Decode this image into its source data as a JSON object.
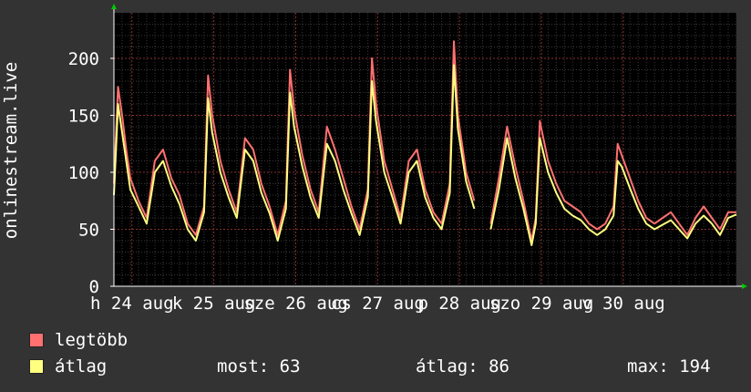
{
  "chart_data": {
    "type": "line",
    "ylabel": "onlinestream.live",
    "ylim": [
      0,
      240
    ],
    "yticks": [
      0,
      50,
      100,
      150,
      200
    ],
    "xlim": [
      0,
      7.6
    ],
    "x_labels": [
      {
        "x": 0.22,
        "text": "h 24 aug"
      },
      {
        "x": 1.22,
        "text": "k 25 aug"
      },
      {
        "x": 2.22,
        "text": "sze 26 aug"
      },
      {
        "x": 3.22,
        "text": "cs 27 aug"
      },
      {
        "x": 4.22,
        "text": "p 28 aug"
      },
      {
        "x": 5.22,
        "text": "szo 29 aug"
      },
      {
        "x": 6.22,
        "text": "v 30 aug"
      }
    ],
    "grid": true,
    "series": [
      {
        "name": "legtöbb",
        "color": "#ff7070",
        "x": [
          0,
          0.05,
          0.1,
          0.15,
          0.2,
          0.3,
          0.4,
          0.5,
          0.6,
          0.7,
          0.8,
          0.9,
          1.0,
          1.1,
          1.15,
          1.2,
          1.3,
          1.4,
          1.5,
          1.6,
          1.7,
          1.8,
          1.9,
          2.0,
          2.1,
          2.15,
          2.2,
          2.3,
          2.4,
          2.5,
          2.6,
          2.7,
          2.8,
          2.9,
          3.0,
          3.1,
          3.15,
          3.2,
          3.3,
          3.4,
          3.5,
          3.6,
          3.7,
          3.8,
          3.9,
          4.0,
          4.1,
          4.15,
          4.2,
          4.3,
          4.4,
          4.5,
          4.6,
          4.7,
          4.8,
          4.9,
          5.0,
          5.1,
          5.15,
          5.2,
          5.3,
          5.4,
          5.5,
          5.6,
          5.7,
          5.8,
          5.9,
          6.0,
          6.1,
          6.15,
          6.2,
          6.3,
          6.4,
          6.5,
          6.6,
          6.7,
          6.8,
          6.9,
          7.0,
          7.1,
          7.2,
          7.3,
          7.4,
          7.5,
          7.6
        ],
        "values": [
          90,
          175,
          150,
          120,
          95,
          75,
          60,
          110,
          120,
          95,
          80,
          55,
          45,
          70,
          185,
          150,
          110,
          85,
          65,
          130,
          120,
          90,
          70,
          45,
          75,
          190,
          155,
          115,
          85,
          65,
          140,
          120,
          95,
          70,
          50,
          85,
          200,
          160,
          110,
          85,
          60,
          110,
          120,
          85,
          65,
          55,
          90,
          215,
          150,
          100,
          75,
          null,
          55,
          95,
          140,
          105,
          75,
          40,
          60,
          145,
          110,
          90,
          75,
          70,
          65,
          55,
          50,
          55,
          70,
          125,
          115,
          95,
          75,
          60,
          55,
          60,
          65,
          55,
          45,
          60,
          70,
          60,
          50,
          65,
          65
        ]
      },
      {
        "name": "átlag",
        "color": "#ffff80",
        "x": [
          0,
          0.05,
          0.1,
          0.15,
          0.2,
          0.3,
          0.4,
          0.5,
          0.6,
          0.7,
          0.8,
          0.9,
          1.0,
          1.1,
          1.15,
          1.2,
          1.3,
          1.4,
          1.5,
          1.6,
          1.7,
          1.8,
          1.9,
          2.0,
          2.1,
          2.15,
          2.2,
          2.3,
          2.4,
          2.5,
          2.6,
          2.7,
          2.8,
          2.9,
          3.0,
          3.1,
          3.15,
          3.2,
          3.3,
          3.4,
          3.5,
          3.6,
          3.7,
          3.8,
          3.9,
          4.0,
          4.1,
          4.15,
          4.2,
          4.3,
          4.4,
          4.5,
          4.6,
          4.7,
          4.8,
          4.9,
          5.0,
          5.1,
          5.15,
          5.2,
          5.3,
          5.4,
          5.5,
          5.6,
          5.7,
          5.8,
          5.9,
          6.0,
          6.1,
          6.15,
          6.2,
          6.3,
          6.4,
          6.5,
          6.6,
          6.7,
          6.8,
          6.9,
          7.0,
          7.1,
          7.2,
          7.3,
          7.4,
          7.5,
          7.6
        ],
        "values": [
          80,
          160,
          135,
          110,
          85,
          70,
          55,
          100,
          110,
          88,
          72,
          50,
          40,
          65,
          165,
          135,
          100,
          78,
          60,
          120,
          110,
          82,
          64,
          40,
          68,
          170,
          140,
          105,
          78,
          60,
          125,
          110,
          85,
          64,
          45,
          78,
          180,
          145,
          100,
          78,
          55,
          100,
          110,
          78,
          60,
          50,
          82,
          194,
          138,
          92,
          68,
          null,
          50,
          85,
          130,
          95,
          68,
          36,
          55,
          130,
          100,
          82,
          68,
          62,
          58,
          50,
          45,
          50,
          62,
          110,
          105,
          86,
          68,
          55,
          50,
          54,
          58,
          50,
          42,
          55,
          62,
          55,
          45,
          60,
          63
        ]
      }
    ]
  },
  "legend": [
    {
      "label": "legtöbb",
      "color": "#ff7070"
    },
    {
      "label": "átlag",
      "color": "#ffff80"
    }
  ],
  "stats": {
    "most": "most: 63",
    "atlag": "átlag: 86",
    "max": "max: 194"
  }
}
